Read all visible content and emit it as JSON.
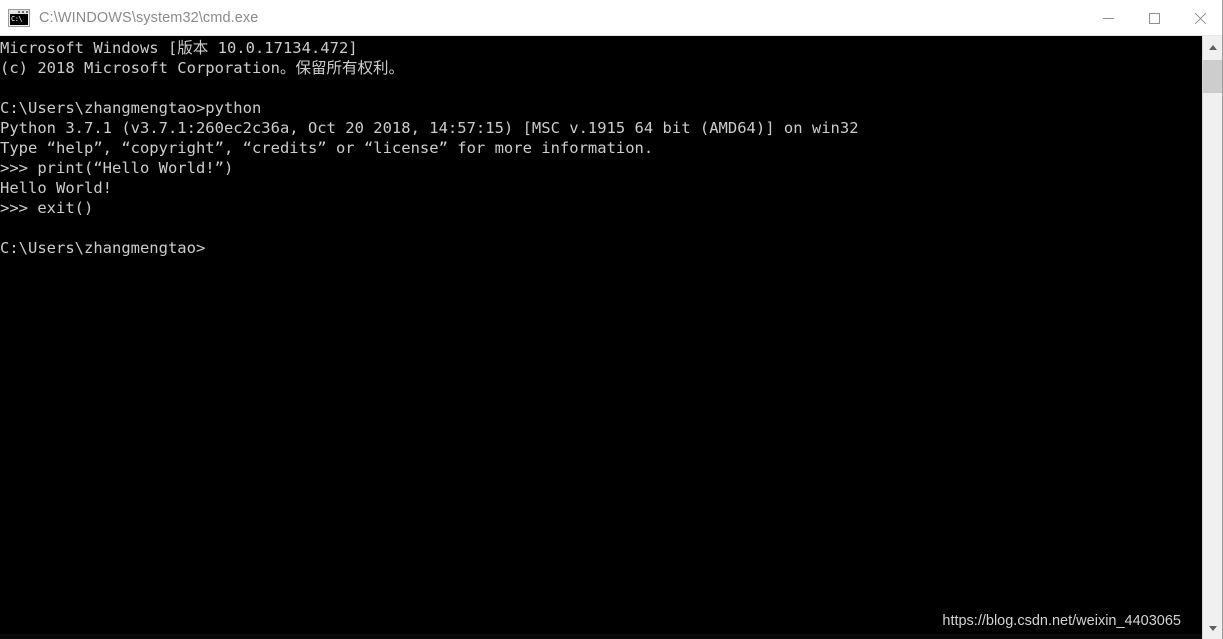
{
  "window": {
    "title": "C:\\WINDOWS\\system32\\cmd.exe",
    "icon_name": "cmd-icon",
    "icon_text": "C:\\",
    "controls": {
      "minimize_label": "Minimize",
      "maximize_label": "Maximize",
      "close_label": "Close"
    },
    "colors": {
      "titlebar_bg": "#ffffff",
      "title_text": "#8b8b8b",
      "console_bg": "#000000",
      "console_text": "#cccccc",
      "scrollbar_track": "#f0f0f0",
      "scrollbar_thumb": "#cdcdcd"
    }
  },
  "console": {
    "lines": [
      "Microsoft Windows [版本 10.0.17134.472]",
      "(c) 2018 Microsoft Corporation。保留所有权利。",
      "",
      "C:\\Users\\zhangmengtao>python",
      "Python 3.7.1 (v3.7.1:260ec2c36a, Oct 20 2018, 14:57:15) [MSC v.1915 64 bit (AMD64)] on win32",
      "Type “help”, “copyright”, “credits” or “license” for more information.",
      ">>> print(“Hello World!”)",
      "Hello World!",
      ">>> exit()",
      "",
      "C:\\Users\\zhangmengtao>"
    ],
    "text": "Microsoft Windows [版本 10.0.17134.472]\n(c) 2018 Microsoft Corporation。保留所有权利。\n\nC:\\Users\\zhangmengtao>python\nPython 3.7.1 (v3.7.1:260ec2c36a, Oct 20 2018, 14:57:15) [MSC v.1915 64 bit (AMD64)] on win32\nType “help”, “copyright”, “credits” or “license” for more information.\n>>> print(“Hello World!”)\nHello World!\n>>> exit()\n\nC:\\Users\\zhangmengtao>"
  },
  "watermark": {
    "text": "https://blog.csdn.net/weixin_4403065"
  },
  "scrollbar": {
    "up_arrow_name": "scroll-up-arrow",
    "down_arrow_name": "scroll-down-arrow"
  }
}
